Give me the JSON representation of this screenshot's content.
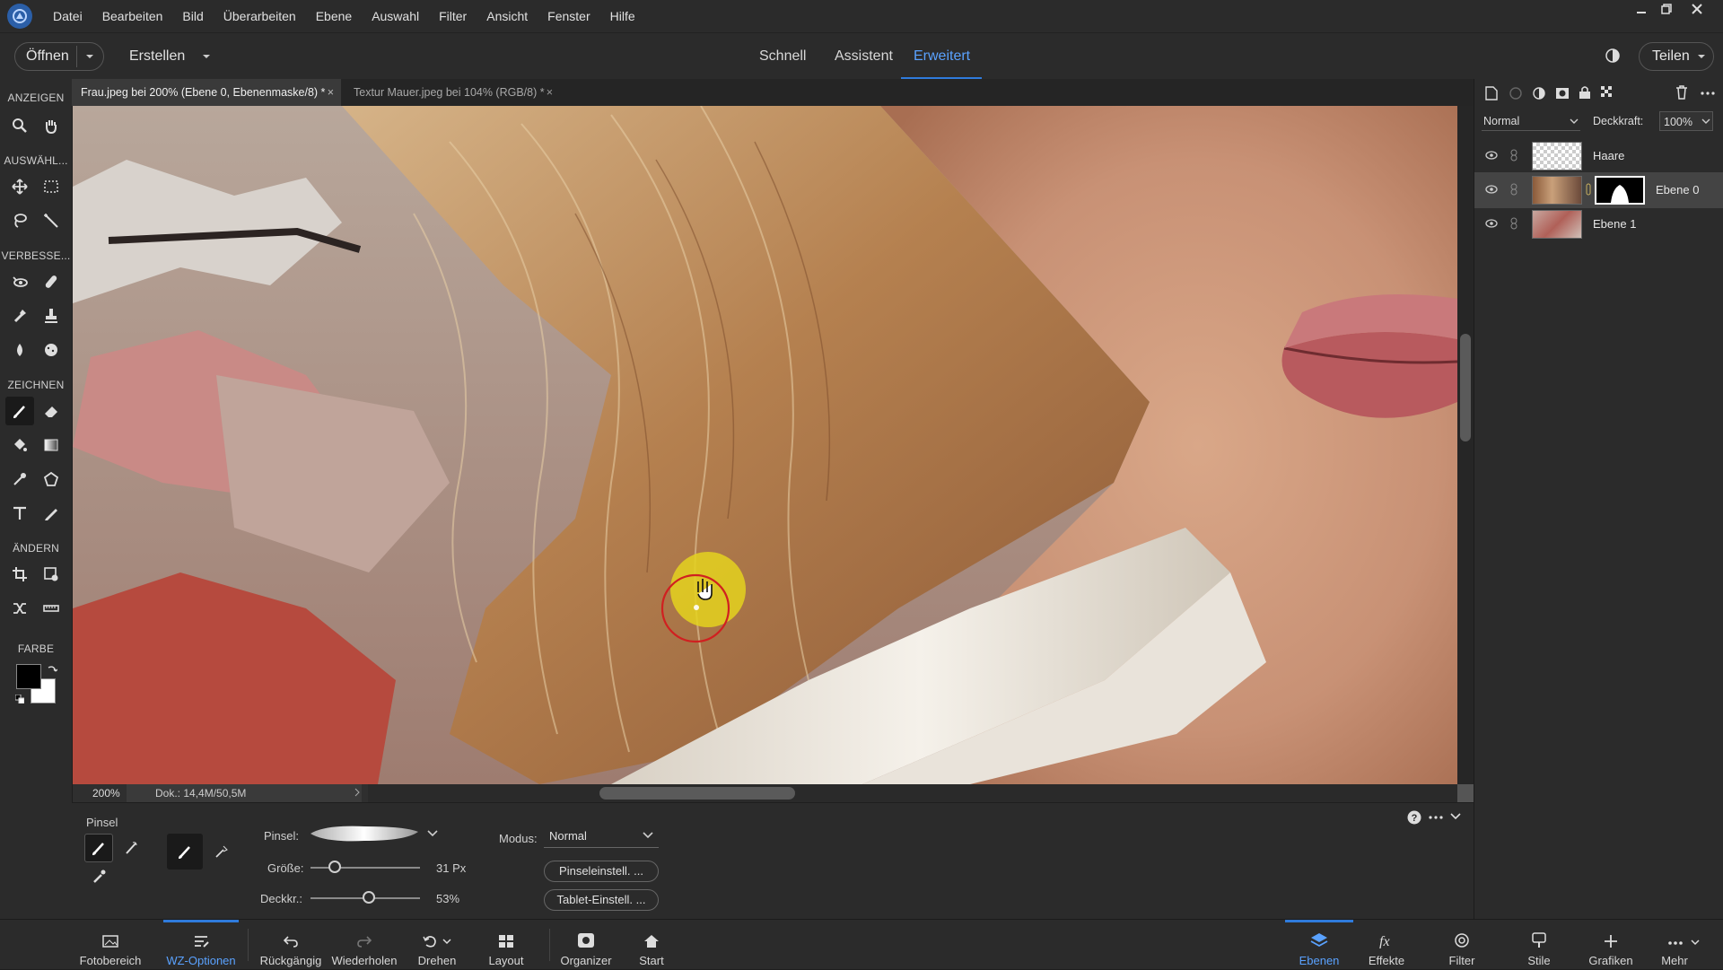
{
  "menu": [
    "Datei",
    "Bearbeiten",
    "Bild",
    "Überarbeiten",
    "Ebene",
    "Auswahl",
    "Filter",
    "Ansicht",
    "Fenster",
    "Hilfe"
  ],
  "topbar": {
    "open_label": "Öffnen",
    "create_label": "Erstellen",
    "modes": [
      "Schnell",
      "Assistent",
      "Erweitert"
    ],
    "active_mode": "Erweitert",
    "share_label": "Teilen"
  },
  "toolbox": {
    "sections": [
      "ANZEIGEN",
      "AUSWÄHL...",
      "VERBESSE...",
      "ZEICHNEN",
      "ÄNDERN",
      "FARBE"
    ]
  },
  "documents": [
    {
      "title": "Frau.jpeg bei 200% (Ebene 0, Ebenenmaske/8) *",
      "active": true
    },
    {
      "title": "Textur Mauer.jpeg bei 104% (RGB/8) *",
      "active": false
    }
  ],
  "status": {
    "zoom": "200%",
    "doc_size": "Dok.: 14,4M/50,5M"
  },
  "options": {
    "tool_name": "Pinsel",
    "brush_label": "Pinsel:",
    "size_label": "Größe:",
    "size_value": "31 Px",
    "size_fraction": 0.22,
    "opacity_label": "Deckkr.:",
    "opacity_value": "53%",
    "opacity_fraction": 0.53,
    "mode_label": "Modus:",
    "mode_value": "Normal",
    "brush_settings_label": "Pinseleinstell. ...",
    "tablet_settings_label": "Tablet-Einstell. ..."
  },
  "layers_panel": {
    "blend_mode": "Normal",
    "opacity_label": "Deckkraft:",
    "opacity_value": "100%",
    "layers": [
      {
        "name": "Haare",
        "active": false
      },
      {
        "name": "Ebene 0",
        "active": true
      },
      {
        "name": "Ebene 1",
        "active": false
      }
    ]
  },
  "bottombar": {
    "left": [
      "Fotobereich",
      "WZ-Optionen",
      "Rückgängig",
      "Wiederholen",
      "Drehen",
      "Layout",
      "Organizer",
      "Start"
    ],
    "left_active": "WZ-Optionen",
    "right": [
      "Ebenen",
      "Effekte",
      "Filter",
      "Stile",
      "Grafiken",
      "Mehr"
    ],
    "right_active": "Ebenen"
  },
  "colors": {
    "accent": "#2f7bdc",
    "accent_text": "#5aa2ff",
    "panel": "#2b2b2b",
    "brush_cursor": "#d02020",
    "click_marker": "#e4d21e"
  }
}
